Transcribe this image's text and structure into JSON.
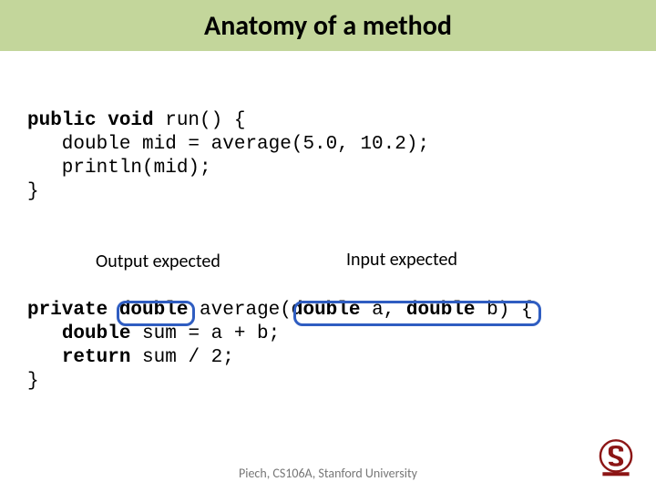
{
  "title": "Anatomy of a method",
  "code": {
    "run": {
      "sig_kw": "public void",
      "sig_rest": " run() {",
      "l1": "   double mid = average(5.0, 10.2);",
      "l2": "   println(mid);",
      "close": "}"
    },
    "avg": {
      "sig_kw1": "private",
      "sig_sp1": " ",
      "ret_type": "double",
      "sig_sp2": " average(",
      "p1_kw": "double",
      "p1_rest": " a, ",
      "p2_kw": "double",
      "p2_rest": " b) {",
      "l1_pre": "   ",
      "l1_kw": "double",
      "l1_rest": " sum = a + b;",
      "l2_pre": "   ",
      "l2_kw": "return",
      "l2_rest": " sum / 2;",
      "close": "}"
    }
  },
  "labels": {
    "output": "Output expected",
    "input": "Input expected"
  },
  "footer": "Piech, CS106A, Stanford University",
  "colors": {
    "title_bg": "#c3d69b",
    "highlight_border": "#2f5dc1",
    "logo_red": "#8C1515"
  }
}
